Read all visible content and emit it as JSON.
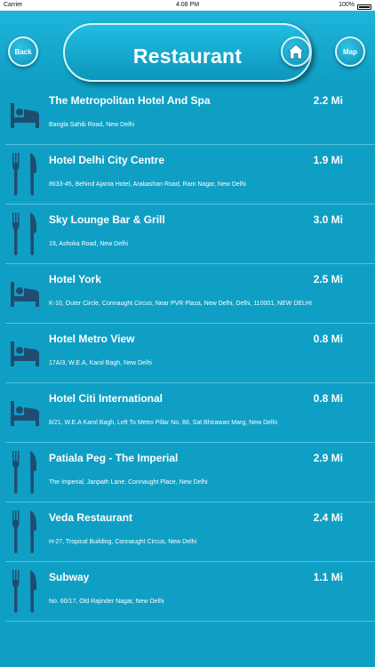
{
  "status": {
    "carrier": "Carrier",
    "time": "4:08 PM",
    "battery": "100%"
  },
  "header": {
    "back_label": "Back",
    "title": "Restaurant",
    "map_label": "Map"
  },
  "items": [
    {
      "type": "hotel",
      "icon": "bed-icon",
      "name": "The Metropolitan Hotel And Spa",
      "distance": "2.2 Mi",
      "address": "Bangla Sahib Road, New Delhi"
    },
    {
      "type": "restaurant",
      "icon": "fork-knife-icon",
      "name": "Hotel Delhi City Centre",
      "distance": "1.9 Mi",
      "address": "8633-45, Behind Ajanta Hotel, Arakashan Road, Ram Nagar, New Delhi"
    },
    {
      "type": "restaurant",
      "icon": "fork-knife-icon",
      "name": "Sky Lounge Bar & Grill",
      "distance": "3.0 Mi",
      "address": "19, Ashoka Road, New Delhi"
    },
    {
      "type": "hotel",
      "icon": "bed-icon",
      "name": "Hotel York",
      "distance": "2.5 Mi",
      "address": "K-10, Outer Circle, Connaught Circus, Near PVR Plaza, New Delhi, Delhi, 110001, NEW DELHI"
    },
    {
      "type": "hotel",
      "icon": "bed-icon",
      "name": "Hotel Metro View",
      "distance": "0.8 Mi",
      "address": "17A/3, W.E.A, Karol Bagh, New Delhi"
    },
    {
      "type": "hotel",
      "icon": "bed-icon",
      "name": "Hotel Citi International",
      "distance": "0.8 Mi",
      "address": "8/21, W.E.A Karol Bagh, Left To Metro Pillar No. 88, Sat Bhirawan Marg, New Delhi"
    },
    {
      "type": "restaurant",
      "icon": "fork-knife-icon",
      "name": "Patiala Peg - The Imperial",
      "distance": "2.9 Mi",
      "address": "The Imperial, Janpath Lane, Connaught Place, New Delhi"
    },
    {
      "type": "restaurant",
      "icon": "fork-knife-icon",
      "name": "Veda Restaurant",
      "distance": "2.4 Mi",
      "address": "H-27, Tropical Building, Connaught Circus, New Delhi"
    },
    {
      "type": "restaurant",
      "icon": "fork-knife-icon",
      "name": "Subway",
      "distance": "1.1 Mi",
      "address": "No. 60/17, Old Rajinder Nagar, New Delhi"
    }
  ],
  "colors": {
    "background": "#0f9fc4",
    "icon": "#1f4d72",
    "divider": "#52c2de"
  }
}
